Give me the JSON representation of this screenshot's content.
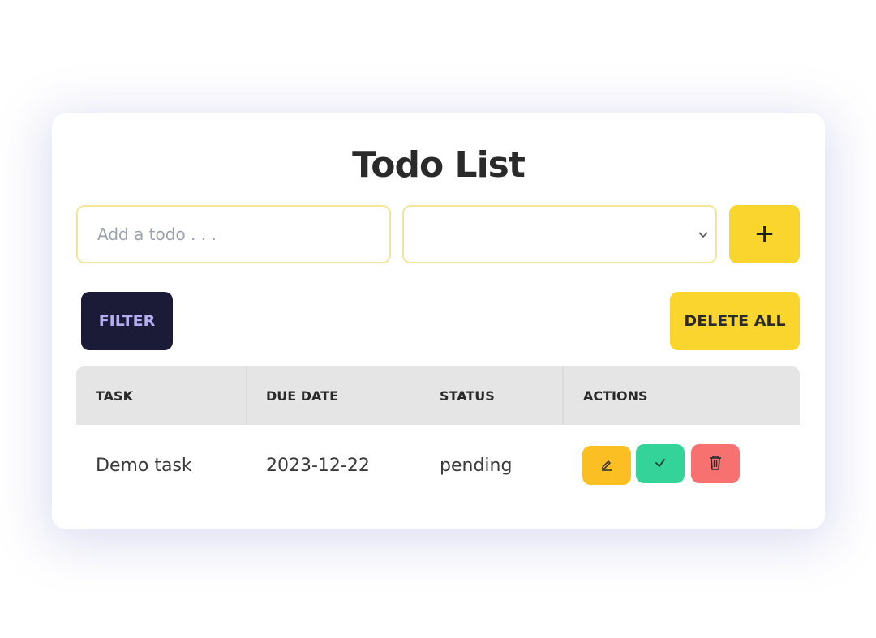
{
  "app": {
    "title": "Todo List"
  },
  "form": {
    "todo_placeholder": "Add a todo . . .",
    "todo_value": "",
    "date_value": "",
    "add_label": "+"
  },
  "toolbar": {
    "filter_label": "FILTER",
    "delete_all_label": "DELETE ALL"
  },
  "table": {
    "headers": [
      "TASK",
      "DUE DATE",
      "STATUS",
      "ACTIONS"
    ],
    "rows": [
      {
        "task": "Demo task",
        "due_date": "2023-12-22",
        "status": "pending"
      }
    ]
  },
  "colors": {
    "accent_yellow": "#fad52e",
    "filter_bg": "#1b1b38",
    "edit": "#fbbf24",
    "complete": "#34d399",
    "delete": "#f87171"
  },
  "icons": {
    "edit": "pencil-icon",
    "complete": "check-icon",
    "delete": "trash-icon",
    "select": "chevron-down-icon"
  }
}
